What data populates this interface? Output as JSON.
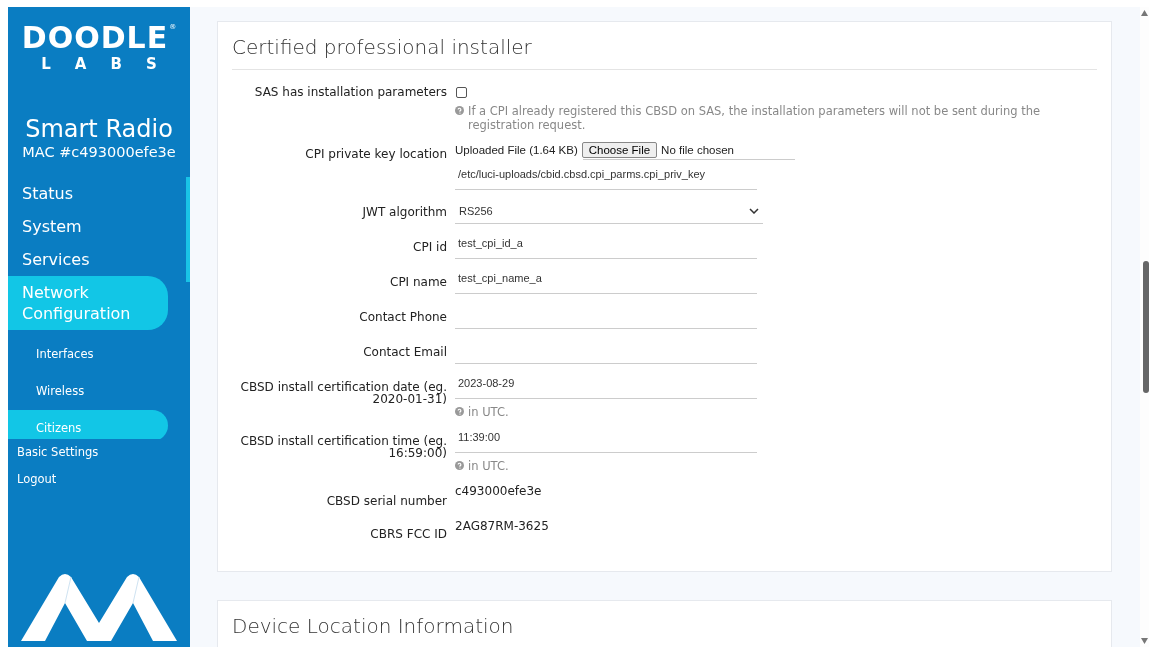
{
  "sidebar": {
    "logo": {
      "brand": "DOODLE",
      "mark": "®",
      "sub": "LABS"
    },
    "product": "Smart Radio",
    "mac": "MAC #c493000efe3e",
    "menu": [
      {
        "label": "Status",
        "selected": false
      },
      {
        "label": "System",
        "selected": false
      },
      {
        "label": "Services",
        "selected": false
      },
      {
        "label": "Network Configuration",
        "selected": true,
        "children": [
          {
            "label": "Interfaces",
            "selected": false
          },
          {
            "label": "Wireless",
            "selected": false
          },
          {
            "label": "Citizens",
            "selected": true
          }
        ]
      }
    ],
    "footer_links": [
      "Basic Settings",
      "Logout"
    ]
  },
  "sections": [
    {
      "title": "Certified professional installer",
      "fields": [
        {
          "kind": "checkbox",
          "label": "SAS has installation parameters",
          "checked": false,
          "help": "If a CPI already registered this CBSD on SAS, the installation parameters will not be sent during the registration request."
        },
        {
          "kind": "file",
          "label": "CPI private key location",
          "status": "Uploaded File (1.64 KB)",
          "button": "Choose File",
          "chosen": "No file chosen",
          "value": "/etc/luci-uploads/cbid.cbsd.cpi_parms.cpi_priv_key"
        },
        {
          "kind": "select",
          "label": "JWT algorithm",
          "value": "RS256"
        },
        {
          "kind": "text",
          "label": "CPI id",
          "value": "test_cpi_id_a"
        },
        {
          "kind": "text",
          "label": "CPI name",
          "value": "test_cpi_name_a"
        },
        {
          "kind": "text",
          "label": "Contact Phone"
        },
        {
          "kind": "text",
          "label": "Contact Email"
        },
        {
          "kind": "text",
          "label": "CBSD install certification date (eg. 2020-01-31)",
          "value": "2023-08-29",
          "help": "in UTC."
        },
        {
          "kind": "text",
          "label": "CBSD install certification time (eg. 16:59:00)",
          "value": "11:39:00",
          "help": "in UTC."
        },
        {
          "kind": "static",
          "label": "CBSD serial number",
          "value": "c493000efe3e"
        },
        {
          "kind": "static",
          "label": "CBRS FCC ID",
          "value": "2AG87RM-3625"
        }
      ]
    },
    {
      "title": "Device Location Information"
    }
  ]
}
